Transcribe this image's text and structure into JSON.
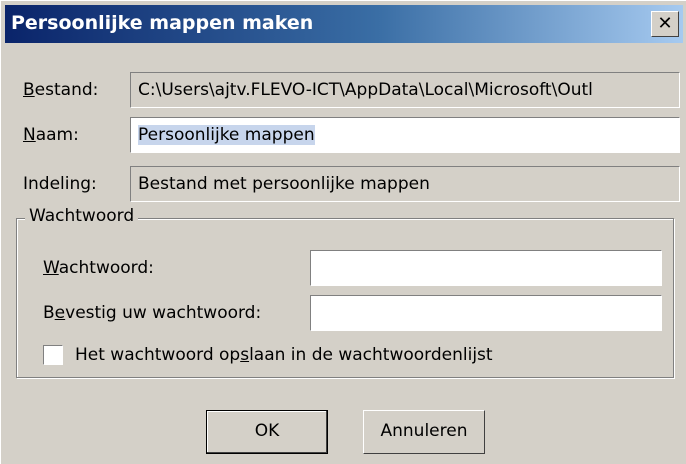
{
  "dialog": {
    "title": "Persoonlijke mappen maken",
    "close_label": "✕"
  },
  "fields": {
    "bestand_label_mn": "B",
    "bestand_label_rest": "estand:",
    "bestand_value": "C:\\Users\\ajtv.FLEVO-ICT\\AppData\\Local\\Microsoft\\Outl",
    "naam_label_mn": "N",
    "naam_label_rest": "aam:",
    "naam_value": "Persoonlijke mappen",
    "indeling_label": "Indeling:",
    "indeling_value": "Bestand met persoonlijke mappen"
  },
  "password_group": {
    "title": "Wachtwoord",
    "password_label_mn": "W",
    "password_label_rest": "achtwoord:",
    "password_value": "",
    "confirm_label_pre": "B",
    "confirm_label_mn": "e",
    "confirm_label_rest": "vestig uw wachtwoord:",
    "confirm_value": "",
    "save_checkbox_checked": false,
    "save_label_pre": "Het wachtwoord op",
    "save_label_mn": "s",
    "save_label_rest": "laan in de wachtwoordenlijst"
  },
  "buttons": {
    "ok": "OK",
    "cancel": "Annuleren"
  }
}
